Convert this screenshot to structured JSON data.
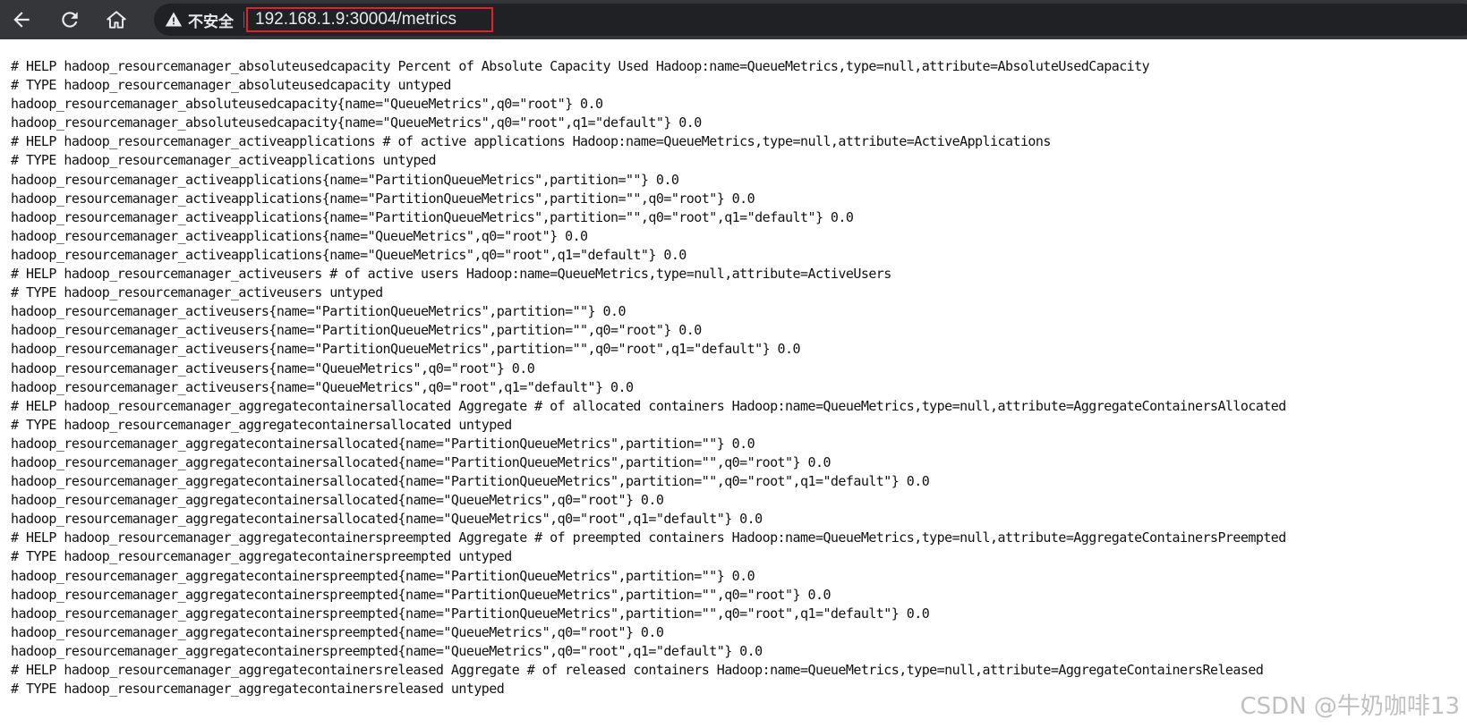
{
  "browser": {
    "security_label": "不安全",
    "url": "192.168.1.9:30004/metrics",
    "icons": [
      "back-arrow-icon",
      "reload-icon",
      "home-icon",
      "warning-triangle-icon"
    ],
    "colors": {
      "toolbar": "#35363a",
      "omnibox": "#202124",
      "url_highlight_border": "#e0202a",
      "page_background": "#ffffff"
    }
  },
  "page": {
    "lines": [
      "# HELP hadoop_resourcemanager_absoluteusedcapacity Percent of Absolute Capacity Used Hadoop:name=QueueMetrics,type=null,attribute=AbsoluteUsedCapacity",
      "# TYPE hadoop_resourcemanager_absoluteusedcapacity untyped",
      "hadoop_resourcemanager_absoluteusedcapacity{name=\"QueueMetrics\",q0=\"root\"} 0.0",
      "hadoop_resourcemanager_absoluteusedcapacity{name=\"QueueMetrics\",q0=\"root\",q1=\"default\"} 0.0",
      "# HELP hadoop_resourcemanager_activeapplications # of active applications Hadoop:name=QueueMetrics,type=null,attribute=ActiveApplications",
      "# TYPE hadoop_resourcemanager_activeapplications untyped",
      "hadoop_resourcemanager_activeapplications{name=\"PartitionQueueMetrics\",partition=\"\"} 0.0",
      "hadoop_resourcemanager_activeapplications{name=\"PartitionQueueMetrics\",partition=\"\",q0=\"root\"} 0.0",
      "hadoop_resourcemanager_activeapplications{name=\"PartitionQueueMetrics\",partition=\"\",q0=\"root\",q1=\"default\"} 0.0",
      "hadoop_resourcemanager_activeapplications{name=\"QueueMetrics\",q0=\"root\"} 0.0",
      "hadoop_resourcemanager_activeapplications{name=\"QueueMetrics\",q0=\"root\",q1=\"default\"} 0.0",
      "# HELP hadoop_resourcemanager_activeusers # of active users Hadoop:name=QueueMetrics,type=null,attribute=ActiveUsers",
      "# TYPE hadoop_resourcemanager_activeusers untyped",
      "hadoop_resourcemanager_activeusers{name=\"PartitionQueueMetrics\",partition=\"\"} 0.0",
      "hadoop_resourcemanager_activeusers{name=\"PartitionQueueMetrics\",partition=\"\",q0=\"root\"} 0.0",
      "hadoop_resourcemanager_activeusers{name=\"PartitionQueueMetrics\",partition=\"\",q0=\"root\",q1=\"default\"} 0.0",
      "hadoop_resourcemanager_activeusers{name=\"QueueMetrics\",q0=\"root\"} 0.0",
      "hadoop_resourcemanager_activeusers{name=\"QueueMetrics\",q0=\"root\",q1=\"default\"} 0.0",
      "# HELP hadoop_resourcemanager_aggregatecontainersallocated Aggregate # of allocated containers Hadoop:name=QueueMetrics,type=null,attribute=AggregateContainersAllocated",
      "# TYPE hadoop_resourcemanager_aggregatecontainersallocated untyped",
      "hadoop_resourcemanager_aggregatecontainersallocated{name=\"PartitionQueueMetrics\",partition=\"\"} 0.0",
      "hadoop_resourcemanager_aggregatecontainersallocated{name=\"PartitionQueueMetrics\",partition=\"\",q0=\"root\"} 0.0",
      "hadoop_resourcemanager_aggregatecontainersallocated{name=\"PartitionQueueMetrics\",partition=\"\",q0=\"root\",q1=\"default\"} 0.0",
      "hadoop_resourcemanager_aggregatecontainersallocated{name=\"QueueMetrics\",q0=\"root\"} 0.0",
      "hadoop_resourcemanager_aggregatecontainersallocated{name=\"QueueMetrics\",q0=\"root\",q1=\"default\"} 0.0",
      "# HELP hadoop_resourcemanager_aggregatecontainerspreempted Aggregate # of preempted containers Hadoop:name=QueueMetrics,type=null,attribute=AggregateContainersPreempted",
      "# TYPE hadoop_resourcemanager_aggregatecontainerspreempted untyped",
      "hadoop_resourcemanager_aggregatecontainerspreempted{name=\"PartitionQueueMetrics\",partition=\"\"} 0.0",
      "hadoop_resourcemanager_aggregatecontainerspreempted{name=\"PartitionQueueMetrics\",partition=\"\",q0=\"root\"} 0.0",
      "hadoop_resourcemanager_aggregatecontainerspreempted{name=\"PartitionQueueMetrics\",partition=\"\",q0=\"root\",q1=\"default\"} 0.0",
      "hadoop_resourcemanager_aggregatecontainerspreempted{name=\"QueueMetrics\",q0=\"root\"} 0.0",
      "hadoop_resourcemanager_aggregatecontainerspreempted{name=\"QueueMetrics\",q0=\"root\",q1=\"default\"} 0.0",
      "# HELP hadoop_resourcemanager_aggregatecontainersreleased Aggregate # of released containers Hadoop:name=QueueMetrics,type=null,attribute=AggregateContainersReleased",
      "# TYPE hadoop_resourcemanager_aggregatecontainersreleased untyped"
    ],
    "watermark": "CSDN @牛奶咖啡13"
  }
}
